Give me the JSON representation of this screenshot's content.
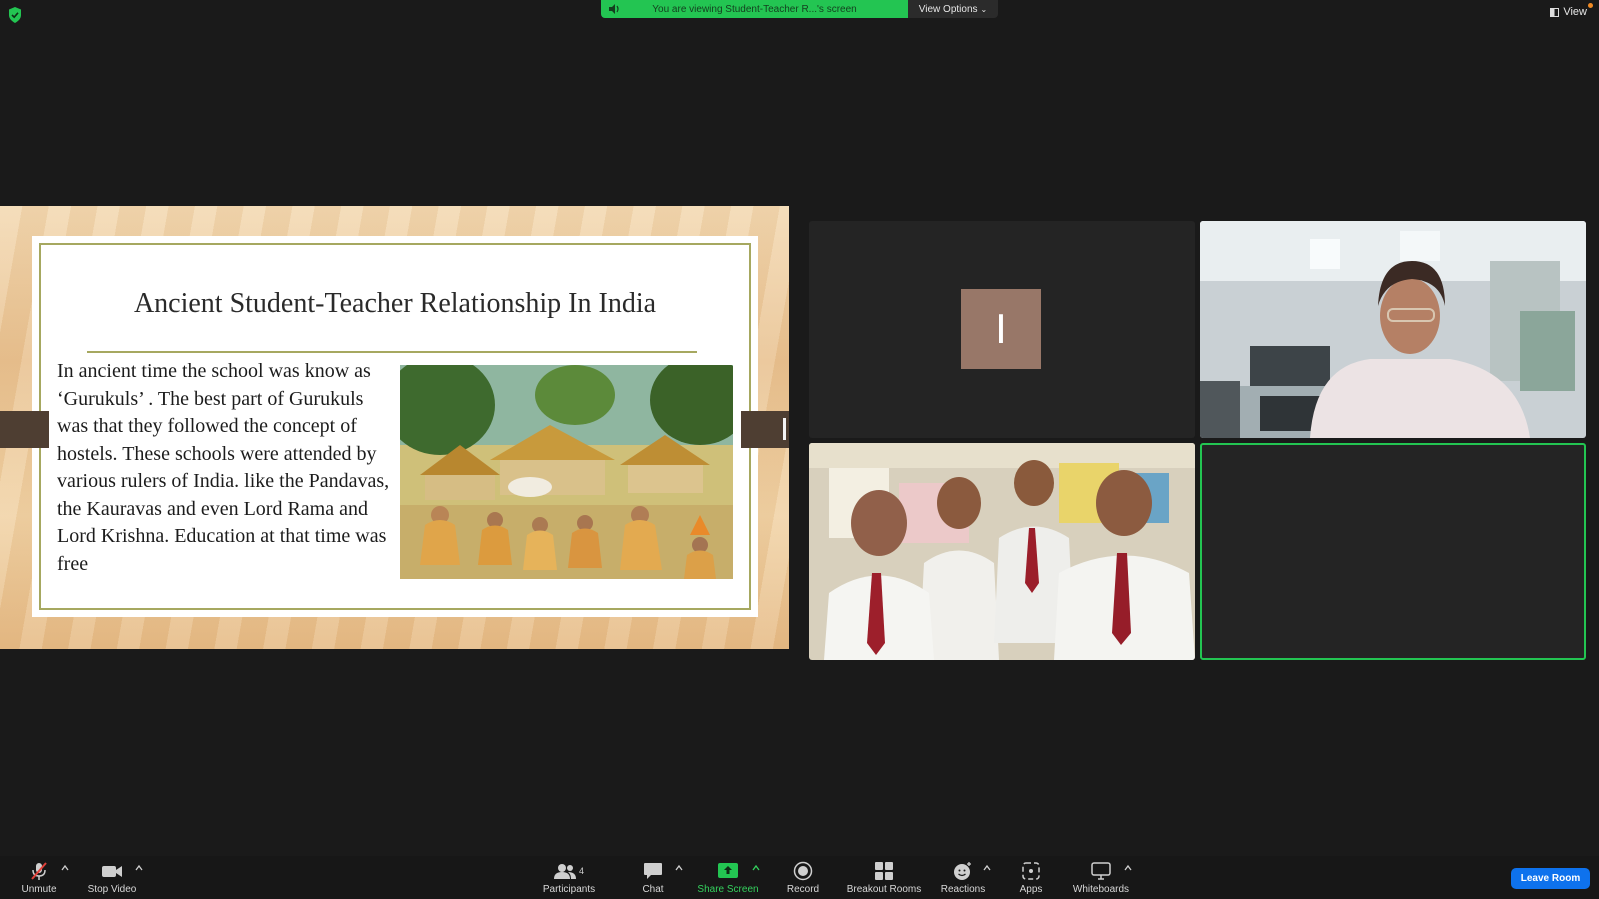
{
  "banner": {
    "sharing_text": "You are viewing Student-Teacher R...'s screen",
    "view_options_label": "View Options",
    "view_label": "View"
  },
  "slide": {
    "title": "Ancient Student-Teacher Relationship In India",
    "body": "In ancient time  the school was know as ‘Gurukuls’ . The best part of Gurukuls was that they followed the concept of hostels. These schools were attended by various rulers of India. like the Pandavas, the Kauravas and even Lord Rama and Lord Krishna. Education at that time was free"
  },
  "participants": {
    "avatar_initial": "I",
    "count": "4"
  },
  "toolbar": {
    "unmute": "Unmute",
    "stop_video": "Stop Video",
    "participants": "Participants",
    "chat": "Chat",
    "share_screen": "Share Screen",
    "record": "Record",
    "breakout_rooms": "Breakout Rooms",
    "reactions": "Reactions",
    "apps": "Apps",
    "whiteboards": "Whiteboards",
    "leave_room": "Leave Room"
  },
  "colors": {
    "share_green": "#23c552",
    "leave_blue": "#0e72ed",
    "active_speaker_border": "#23c552",
    "avatar_bg": "#987768"
  }
}
